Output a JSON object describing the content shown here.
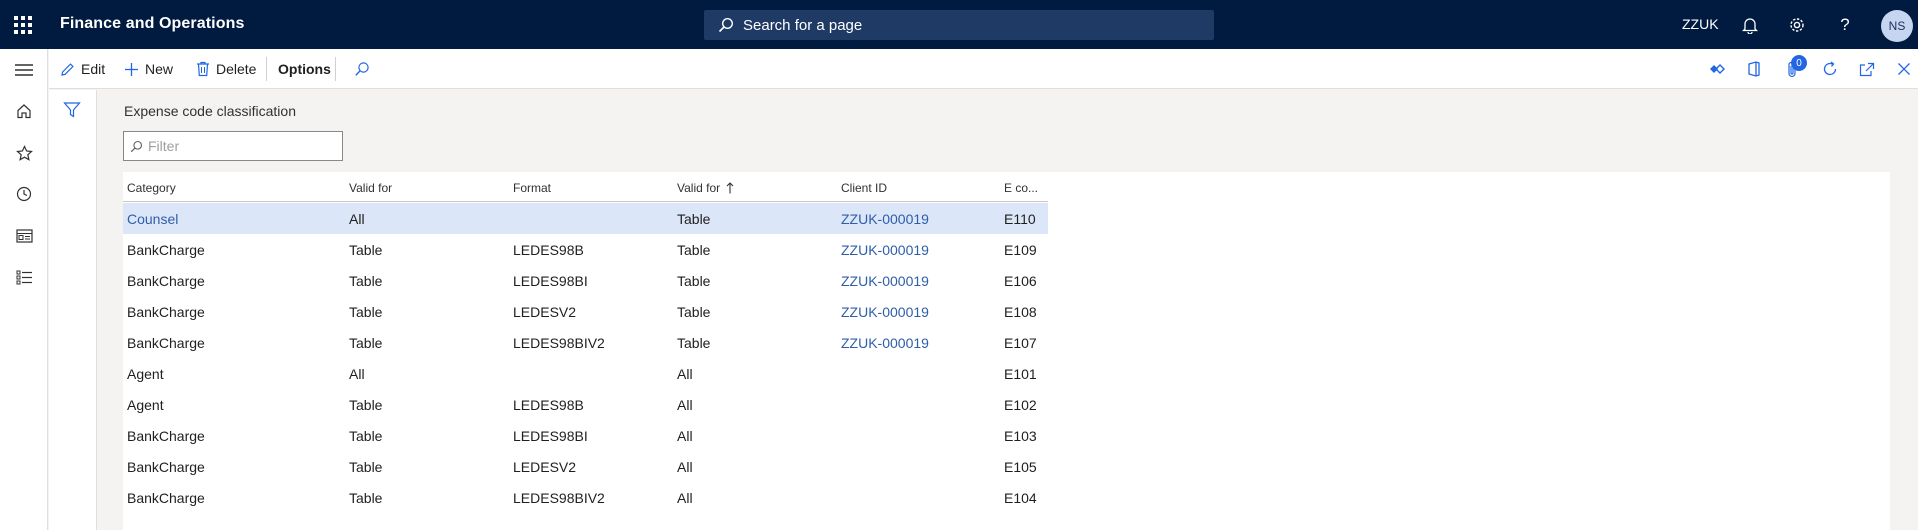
{
  "app": {
    "title": "Finance and Operations",
    "search_placeholder": "Search for a page",
    "company": "ZZUK",
    "user_initials": "NS"
  },
  "actions": {
    "edit": "Edit",
    "new": "New",
    "delete": "Delete",
    "options": "Options",
    "attachments_count": "0"
  },
  "page": {
    "title": "Expense code classification",
    "filter_placeholder": "Filter"
  },
  "grid": {
    "columns": [
      "Category",
      "Valid for",
      "Format",
      "Valid for",
      "Client ID",
      "E co..."
    ],
    "sorted_column_index": 3,
    "selected_row_index": 0,
    "rows": [
      [
        "Counsel",
        "All",
        "",
        "Table",
        "ZZUK-000019",
        "E110"
      ],
      [
        "BankCharge",
        "Table",
        "LEDES98B",
        "Table",
        "ZZUK-000019",
        "E109"
      ],
      [
        "BankCharge",
        "Table",
        "LEDES98BI",
        "Table",
        "ZZUK-000019",
        "E106"
      ],
      [
        "BankCharge",
        "Table",
        "LEDESV2",
        "Table",
        "ZZUK-000019",
        "E108"
      ],
      [
        "BankCharge",
        "Table",
        "LEDES98BIV2",
        "Table",
        "ZZUK-000019",
        "E107"
      ],
      [
        "Agent",
        "All",
        "",
        "All",
        "",
        "E101"
      ],
      [
        "Agent",
        "Table",
        "LEDES98B",
        "All",
        "",
        "E102"
      ],
      [
        "BankCharge",
        "Table",
        "LEDES98BI",
        "All",
        "",
        "E103"
      ],
      [
        "BankCharge",
        "Table",
        "LEDESV2",
        "All",
        "",
        "E105"
      ],
      [
        "BankCharge",
        "Table",
        "LEDES98BIV2",
        "All",
        "",
        "E104"
      ]
    ]
  },
  "colors": {
    "topbar": "#001b3f",
    "selected_row": "#dbe6f8",
    "link": "#2f5ea8",
    "accent": "#2266e3"
  }
}
